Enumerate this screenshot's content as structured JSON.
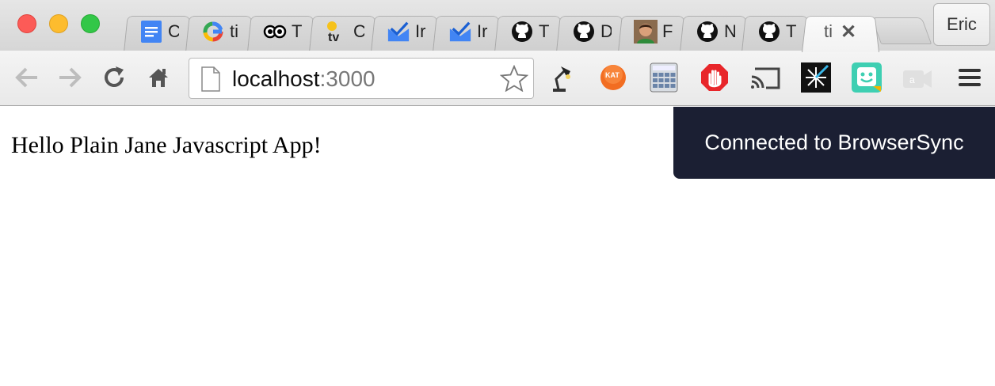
{
  "window": {
    "traffic_lights": [
      "close",
      "minimize",
      "maximize"
    ],
    "profile_name": "Eric"
  },
  "tabs": [
    {
      "label": "C",
      "icon": "google-docs-icon"
    },
    {
      "label": "ti",
      "icon": "google-g-icon"
    },
    {
      "label": "T",
      "icon": "tripadvisor-owl-icon"
    },
    {
      "label": "C",
      "icon": "tv-icon"
    },
    {
      "label": "Ir",
      "icon": "inbox-icon"
    },
    {
      "label": "Ir",
      "icon": "inbox-icon"
    },
    {
      "label": "T",
      "icon": "github-icon"
    },
    {
      "label": "D",
      "icon": "github-icon"
    },
    {
      "label": "F",
      "icon": "photo-avatar-icon"
    },
    {
      "label": "N",
      "icon": "github-icon"
    },
    {
      "label": "T",
      "icon": "github-icon"
    },
    {
      "label": "ti",
      "icon": "",
      "active": true,
      "close": "✕"
    }
  ],
  "toolbar": {
    "url_host": "localhost",
    "url_port": ":3000",
    "extensions": [
      "lamp-icon",
      "kat-icon",
      "calculator-icon",
      "adblock-icon",
      "cast-icon",
      "spark-icon",
      "face-icon",
      "camera-icon"
    ]
  },
  "page": {
    "heading": "Hello Plain Jane Javascript App!",
    "notification": "Connected to BrowserSync"
  },
  "colors": {
    "notification_bg": "#1b1f33",
    "close_light": "#fc5b57",
    "min_light": "#fdbc2e",
    "max_light": "#33c748"
  }
}
